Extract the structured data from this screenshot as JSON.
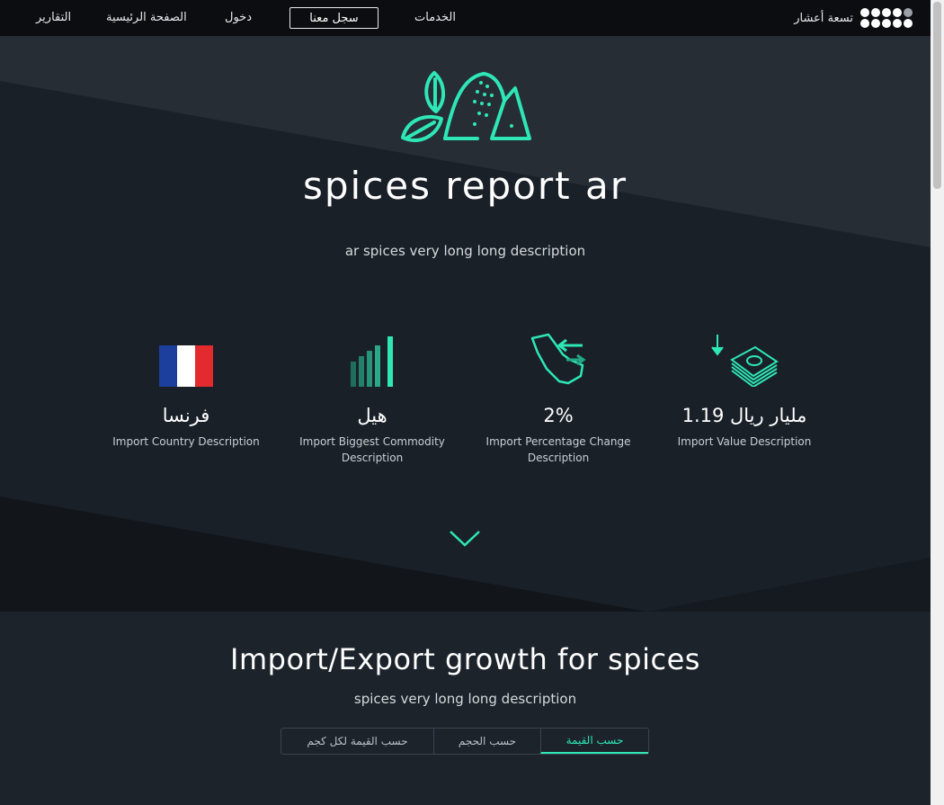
{
  "nav": {
    "brand": "تسعة أعشار",
    "services": "الخدمات",
    "register": "سجل معنا",
    "login": "دخول",
    "home": "الصفحة الرئيسية",
    "reports": "التقارير"
  },
  "hero": {
    "title": "spices report ar",
    "subtitle": "ar spices very long long description"
  },
  "stats": [
    {
      "value": "1.19 مليار ريال",
      "desc": "Import Value Description",
      "icon": "money-import-icon"
    },
    {
      "value": "2%",
      "desc": "Import Percentage Change Description",
      "icon": "saudi-map-exchange-icon"
    },
    {
      "value": "هيل",
      "desc": "Import Biggest Commodity Description",
      "icon": "bar-growth-icon"
    },
    {
      "value": "فرنسا",
      "desc": "Import Country Description",
      "icon": "france-flag-icon"
    }
  ],
  "section": {
    "title": "Import/Export growth for spices",
    "subtitle": "spices very long long description",
    "tabs": [
      "حسب القيمة",
      "حسب الحجم",
      "حسب القيمة لكل كجم"
    ],
    "active_tab": 0
  },
  "colors": {
    "accent": "#2ee6b6",
    "nav_bg": "#0b0d10",
    "page_bg": "#1c232b"
  }
}
